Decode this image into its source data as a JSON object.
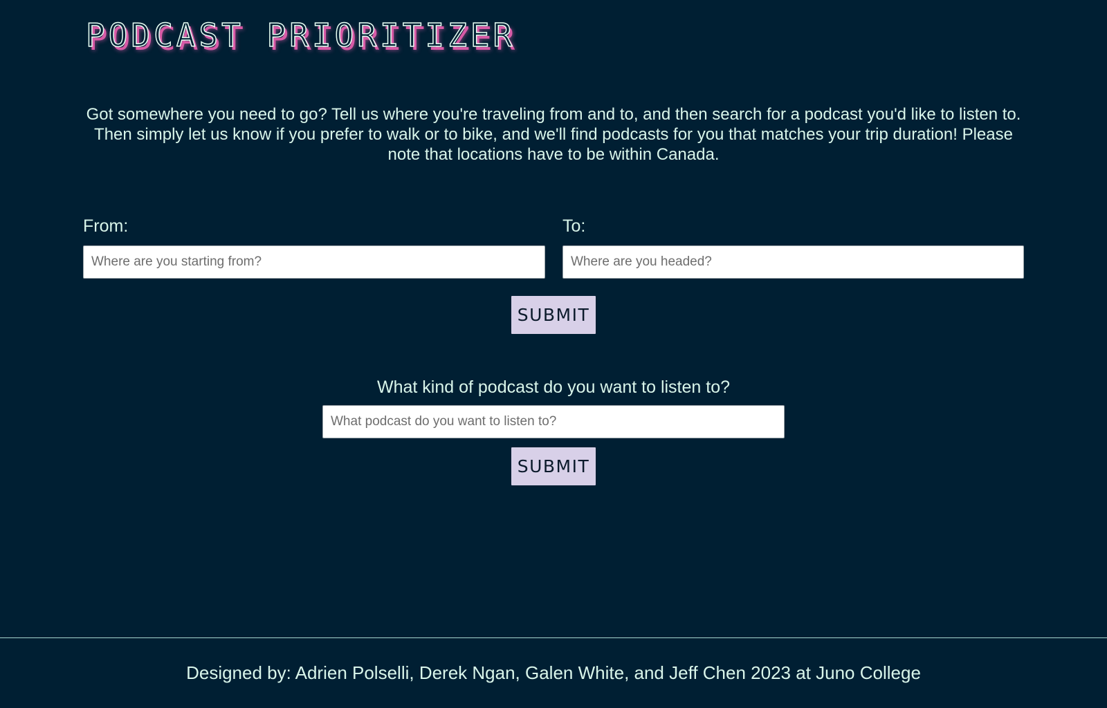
{
  "header": {
    "title": "PODCAST PRIORITIZER"
  },
  "intro": {
    "text": "Got somewhere you need to go? Tell us where you're traveling from and to, and then search for a podcast you'd like to listen to. Then simply let us know if you prefer to walk or to bike, and we'll find podcasts for you that matches your trip duration! Please note that locations have to be within Canada."
  },
  "trip_form": {
    "from_label": "From:",
    "from_value": "",
    "from_placeholder": "Where are you starting from?",
    "to_label": "To:",
    "to_value": "",
    "to_placeholder": "Where are you headed?",
    "submit_label": "SUBMIT"
  },
  "podcast_form": {
    "question": "What kind of podcast do you want to listen to?",
    "search_value": "",
    "search_placeholder": "What podcast do you want to listen to?",
    "submit_label": "SUBMIT"
  },
  "footer": {
    "credits": "Designed by: Adrien Polselli, Derek Ngan, Galen White, and Jeff Chen 2023 at Juno College"
  },
  "colors": {
    "background": "#001f33",
    "text": "#d9f5ea",
    "title_shadow": "#d75aa6",
    "button_bg": "#d8d0e8",
    "button_text": "#0b1a2b"
  }
}
